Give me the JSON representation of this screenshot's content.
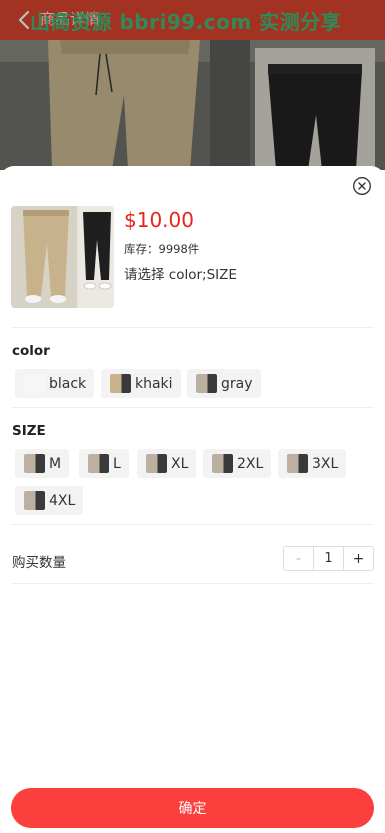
{
  "header": {
    "title": "商品详情",
    "watermark": "山商资源 bbri99.com 实测分享"
  },
  "product": {
    "price": "$10.00",
    "stock": "库存：9998件",
    "selecting": "请选择 color;SIZE"
  },
  "groups": {
    "color": {
      "title": "color",
      "options": [
        "black",
        "khaki",
        "gray"
      ]
    },
    "size": {
      "title": "SIZE",
      "options": [
        "M",
        "L",
        "XL",
        "2XL",
        "3XL",
        "4XL"
      ]
    }
  },
  "quantity": {
    "label": "购买数量",
    "minus": "-",
    "value": "1",
    "plus": "+"
  },
  "confirm_label": "确定",
  "colors": {
    "header_bg": "#d9452f",
    "price": "#e8251c",
    "confirm_bg": "#fa3f3c",
    "watermark": "#33c27a"
  }
}
